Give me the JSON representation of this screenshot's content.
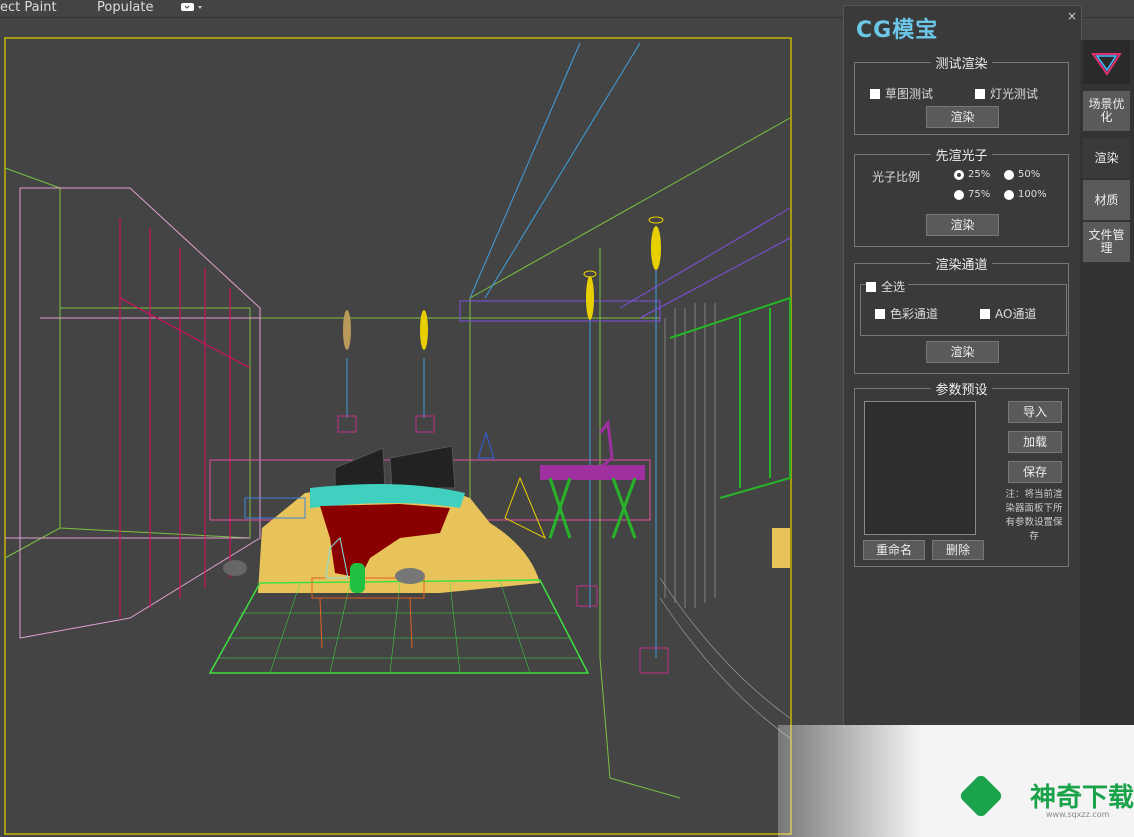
{
  "topbar": {
    "item1": "ect Paint",
    "item2": "Populate"
  },
  "panel": {
    "logo": "CG模宝",
    "close": "×",
    "test_render": {
      "legend": "测试渲染",
      "draft_test": "草图测试",
      "light_test": "灯光测试",
      "render": "渲染"
    },
    "photon": {
      "legend": "先渲光子",
      "ratio_label": "光子比例",
      "options": [
        "25%",
        "50%",
        "75%",
        "100%"
      ],
      "selected": "25%",
      "render": "渲染"
    },
    "channels": {
      "legend": "渲染通道",
      "select_all": "全选",
      "color_channel": "色彩通道",
      "ao_channel": "AO通道",
      "render": "渲染"
    },
    "presets": {
      "legend": "参数预设",
      "import": "导入",
      "load": "加载",
      "save": "保存",
      "note": "注：将当前渲染器面板下所有参数设置保存",
      "rename": "重命名",
      "delete": "删除"
    }
  },
  "tabs": [
    {
      "label": "场景优化"
    },
    {
      "label": "渲染"
    },
    {
      "label": "材质"
    },
    {
      "label": "文件管理"
    }
  ],
  "watermark": {
    "text": "神奇下载",
    "url": "www.sqxzz.com"
  }
}
